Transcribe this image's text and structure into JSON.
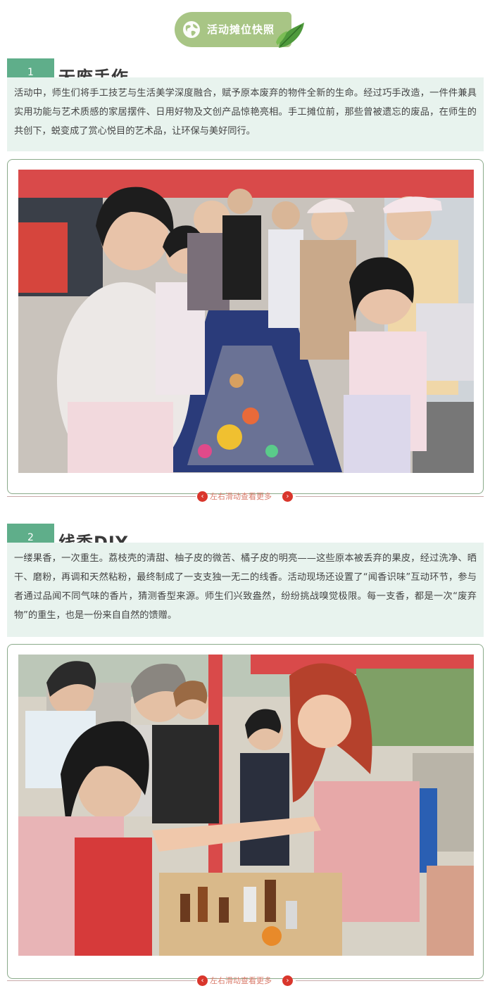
{
  "header": {
    "title": "活动摊位快照",
    "icons": [
      "globe-icon",
      "leaf-icon"
    ]
  },
  "sections": [
    {
      "number": "1",
      "title": "无废手作",
      "paragraph": "活动中，师生们将手工技艺与生活美学深度融合，赋予原本废弃的物件全新的生命。经过巧手改造，一件件兼具实用功能与艺术质感的家居摆件、日用好物及文创产品惊艳亮相。手工摊位前，那些曾被遗忘的废品，在师生的共创下，蜕变成了赏心悦目的艺术品，让环保与美好同行。",
      "photo_description_icon": "photo-handicraft-stall",
      "swipe_hint": "左右滑动查看更多"
    },
    {
      "number": "2",
      "title": "线香DIY",
      "paragraph": "一缕果香，一次重生。荔枝壳的清甜、柚子皮的微苦、橘子皮的明亮——这些原本被丢弃的果皮，经过洗净、晒干、磨粉，再调和天然粘粉，最终制成了一支支独一无二的线香。活动现场还设置了“闻香识味”互动环节，参与者通过品闻不同气味的香片，猜测香型来源。师生们兴致盎然，纷纷挑战嗅觉极限。每一支香，都是一次“废弃物”的重生，也是一份来自自然的馈赠。",
      "photo_description_icon": "photo-incense-stall",
      "swipe_hint": "左右滑动查看更多"
    }
  ],
  "colors": {
    "pill": "#a8c585",
    "badge": "#5fae8a",
    "text_bg": "#e8f3ee",
    "arrow": "#d9362c"
  }
}
